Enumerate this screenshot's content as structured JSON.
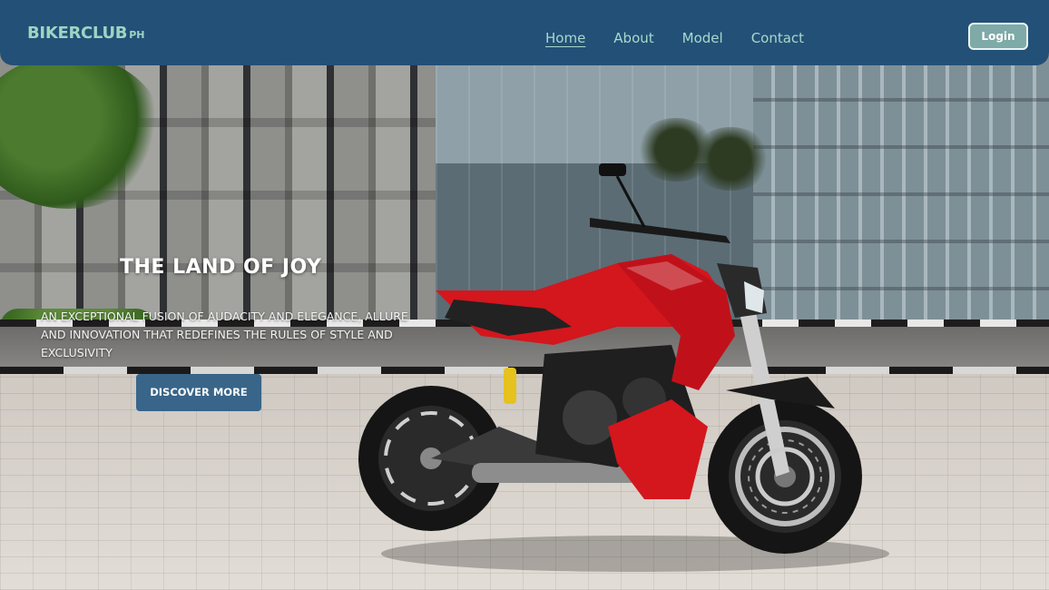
{
  "brand": {
    "name": "BIKERCLUB",
    "suffix": "PH"
  },
  "nav": {
    "links": [
      {
        "label": "Home",
        "active": true
      },
      {
        "label": "About"
      },
      {
        "label": "Model"
      },
      {
        "label": "Contact"
      }
    ],
    "login_label": "Login"
  },
  "hero": {
    "title": "THE LAND OF JOY",
    "description": "AN EXCEPTIONAL FUSION OF AUDACITY AND ELEGANCE, ALLURE AND INNOVATION THAT REDEFINES THE RULES OF STYLE AND EXCLUSIVITY",
    "cta_label": "DISCOVER MORE"
  },
  "colors": {
    "navbar": "#235077",
    "brand_text": "#9fd4c3",
    "nav_text": "#a9d8cc",
    "login_bg": "#7eaaa8",
    "cta_bg": "#2c5d84",
    "bike_red": "#d4161d"
  }
}
